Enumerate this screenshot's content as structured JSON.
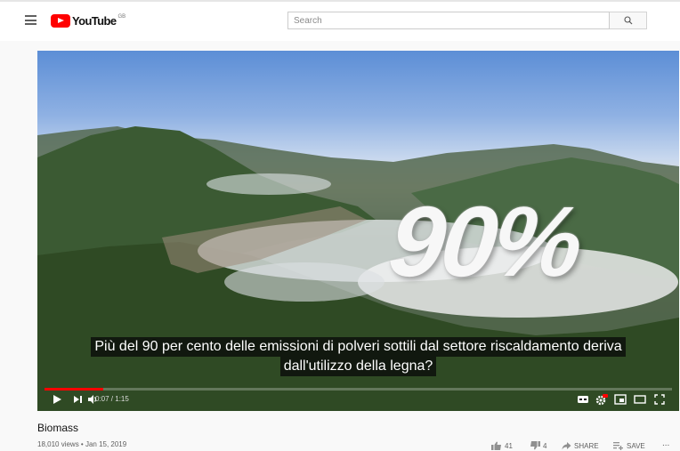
{
  "header": {
    "logo_text": "YouTube",
    "logo_country": "GB",
    "search_placeholder": "Search"
  },
  "video": {
    "overlay_text": "90%",
    "subtitle_line1": "Più del 90 per cento delle emissioni di polveri sottili dal settore riscaldamento deriva",
    "subtitle_line2": "dall'utilizzo della legna?",
    "time_display": "0:07 / 1:15",
    "progress_fraction": 0.093
  },
  "info": {
    "title": "Biomass",
    "meta": "18,010 views • Jan 15, 2019",
    "likes": "41",
    "dislikes": "4",
    "share_label": "SHARE",
    "save_label": "SAVE",
    "more_label": "..."
  },
  "icons": [
    "menu-icon",
    "youtube-logo",
    "search-icon",
    "play-icon",
    "next-icon",
    "volume-icon",
    "captions-icon",
    "settings-icon",
    "miniplayer-icon",
    "theater-icon",
    "fullscreen-icon",
    "like-icon",
    "dislike-icon",
    "share-icon",
    "save-icon",
    "more-icon"
  ],
  "colors": {
    "brand_red": "#ff0000",
    "background": "#f9f9f9"
  }
}
